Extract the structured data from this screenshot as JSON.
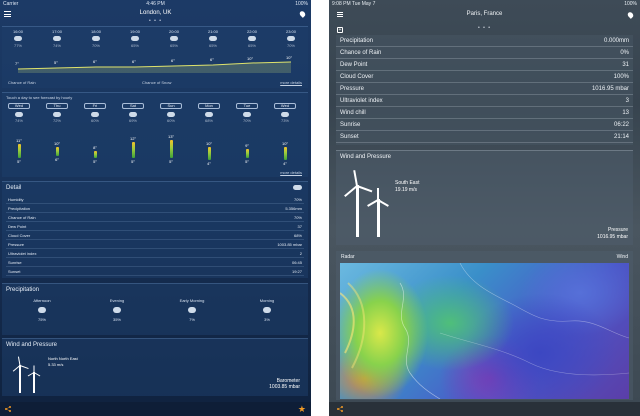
{
  "left": {
    "status": {
      "carrier": "Carrier",
      "time": "4:46 PM",
      "battery": "100%"
    },
    "city": "London, UK",
    "page_dots": "• • •",
    "hourly": {
      "times": [
        "16:00",
        "17:00",
        "18:00",
        "19:00",
        "20:00",
        "21:00",
        "22:00",
        "23:00"
      ],
      "pcts": [
        "77%",
        "74%",
        "70%",
        "65%",
        "65%",
        "65%",
        "65%",
        "70%"
      ],
      "temps": [
        "7°",
        "5°",
        "6°",
        "6°",
        "6°",
        "6°",
        "10°",
        "10°"
      ],
      "chance_rain": "Chance of Rain",
      "chance_snow": "Chance of Snow",
      "more": "more details"
    },
    "daily": {
      "hint": "Touch a day to see forecast by hourly",
      "days": [
        "Wed",
        "Thu",
        "Fri",
        "Sat",
        "Sun",
        "Mon",
        "Tue",
        "Wed"
      ],
      "pcts": [
        "74%",
        "72%",
        "60%",
        "69%",
        "60%",
        "68%",
        "70%",
        "73%"
      ],
      "highs": [
        "11°",
        "10°",
        "8°",
        "12°",
        "13°",
        "10°",
        "9°",
        "10°"
      ],
      "lows": [
        "5°",
        "6°",
        "5°",
        "5°",
        "5°",
        "4°",
        "5°",
        "4°"
      ],
      "more": "more details"
    },
    "detail": {
      "title": "Detail",
      "rows": [
        {
          "k": "Humidity",
          "v": "70%"
        },
        {
          "k": "Precipitation",
          "v": "5.356mm"
        },
        {
          "k": "Chance of Rain",
          "v": "70%"
        },
        {
          "k": "Dew Point",
          "v": "37"
        },
        {
          "k": "Cloud Cover",
          "v": "68%"
        },
        {
          "k": "Pressure",
          "v": "1003.85 mbar"
        },
        {
          "k": "Ultraviolet index",
          "v": "2"
        },
        {
          "k": "Sunrise",
          "v": "06:45"
        },
        {
          "k": "Sunset",
          "v": "19:27"
        }
      ]
    },
    "precipitation": {
      "title": "Precipitation",
      "cols": [
        {
          "label": "Afternoon",
          "pct": "75%"
        },
        {
          "label": "Evening",
          "pct": "35%"
        },
        {
          "label": "Early Morning",
          "pct": "7%"
        },
        {
          "label": "Morning",
          "pct": "3%"
        }
      ]
    },
    "wind": {
      "title": "Wind and Pressure",
      "direction": "North North East",
      "speed": "5.33 m/s",
      "baro_label": "Barometer",
      "baro_value": "1003.85 mbar"
    }
  },
  "right": {
    "status": {
      "time": "9:08 PM  Tue May 7",
      "battery": "100%"
    },
    "city": "Paris, France",
    "page_dots": "• • •",
    "detail_rows": [
      {
        "k": "Precipitation",
        "v": "0.000mm"
      },
      {
        "k": "Chance of Rain",
        "v": "0%"
      },
      {
        "k": "Dew Point",
        "v": "31"
      },
      {
        "k": "Cloud Cover",
        "v": "100%"
      },
      {
        "k": "Pressure",
        "v": "1016.95 mbar"
      },
      {
        "k": "Ultraviolet index",
        "v": "3"
      },
      {
        "k": "Wind chill",
        "v": "13"
      },
      {
        "k": "Sunrise",
        "v": "06:22"
      },
      {
        "k": "Sunset",
        "v": "21:14"
      }
    ],
    "wind": {
      "title": "Wind and Pressure",
      "direction": "South East",
      "speed": "19.19 m/s",
      "pressure_label": "Pressure",
      "pressure_value": "1016.95 mbar"
    },
    "radar": {
      "title": "Radar",
      "mode": "Wind"
    }
  },
  "colors": {
    "accent": "#f29b26",
    "bar_top": "#f4c22b",
    "bar_bottom": "#3fa33a"
  }
}
